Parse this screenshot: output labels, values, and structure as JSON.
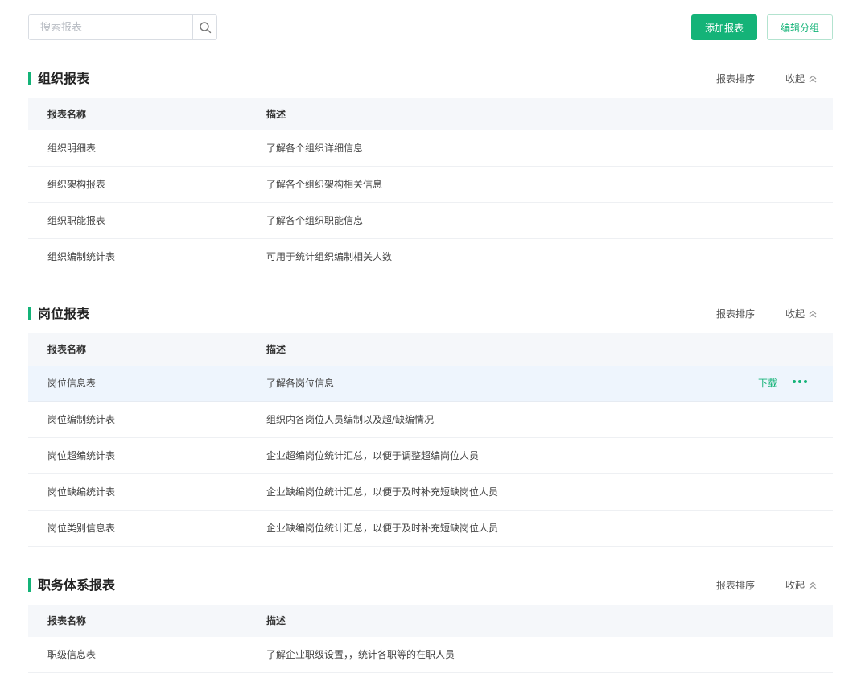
{
  "toolbar": {
    "search_placeholder": "搜索报表",
    "add_label": "添加报表",
    "edit_group_label": "编辑分组"
  },
  "colors": {
    "accent": "#14b378",
    "header_bg": "#f5f7fa",
    "highlight_row": "#eef5fd"
  },
  "sections": [
    {
      "title": "组织报表",
      "sort_label": "报表排序",
      "collapse_label": "收起",
      "headers": [
        "报表名称",
        "描述"
      ],
      "rows": [
        [
          "组织明细表",
          "了解各个组织详细信息"
        ],
        [
          "组织架构报表",
          "了解各个组织架构相关信息"
        ],
        [
          "组织职能报表",
          "了解各个组织职能信息"
        ],
        [
          "组织编制统计表",
          "可用于统计组织编制相关人数"
        ]
      ]
    },
    {
      "title": "岗位报表",
      "sort_label": "报表排序",
      "collapse_label": "收起",
      "headers": [
        "报表名称",
        "描述"
      ],
      "hover_row": {
        "download_label": "下载",
        "more_icon": "more-dots-icon"
      },
      "rows": [
        [
          "岗位信息表",
          "了解各岗位信息"
        ],
        [
          "岗位编制统计表",
          "组织内各岗位人员编制以及超/缺编情况"
        ],
        [
          "岗位超编统计表",
          "企业超编岗位统计汇总，以便于调整超编岗位人员"
        ],
        [
          "岗位缺编统计表",
          "企业缺编岗位统计汇总，以便于及时补充短缺岗位人员"
        ],
        [
          "岗位类别信息表",
          "企业缺编岗位统计汇总，以便于及时补充短缺岗位人员"
        ]
      ]
    },
    {
      "title": "职务体系报表",
      "sort_label": "报表排序",
      "collapse_label": "收起",
      "headers": [
        "报表名称",
        "描述"
      ],
      "rows": [
        [
          "职级信息表",
          "了解企业职级设置，，统计各职等的在职人员"
        ]
      ]
    }
  ]
}
